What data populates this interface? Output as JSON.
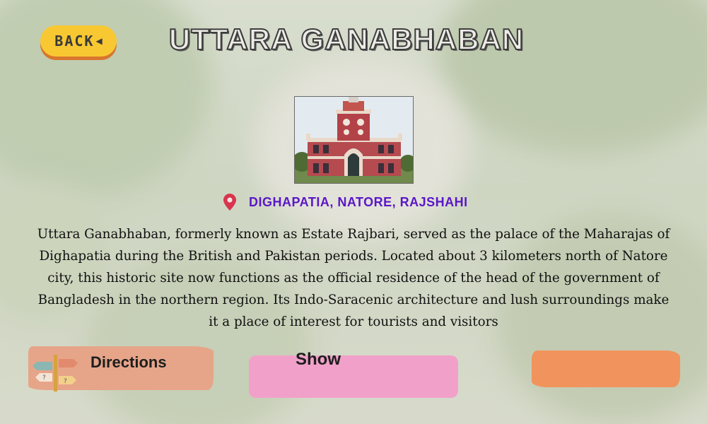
{
  "header": {
    "back_label": "BACK",
    "title": "UTTARA GANABHABAN"
  },
  "location": {
    "text": "DIGHAPATIA, NATORE, RAJSHAHI"
  },
  "description": "Uttara Ganabhaban, formerly known as Estate Rajbari, served as the palace of the Maharajas of Dighapatia during the British and Pakistan periods. Located about 3 kilometers north of Natore city, this historic site now functions as the official residence of the head of the government of Bangladesh in the northern region. Its Indo-Saracenic architecture and lush surroundings make it a place of interest for tourists and visitors",
  "actions": {
    "directions_label": "Directions",
    "show_label": "Show"
  },
  "icons": {
    "back": "back-arrow-icon",
    "location": "map-pin-icon",
    "directions": "signpost-icon"
  },
  "colors": {
    "back_button": "#f8c832",
    "location_text": "#5a16c8",
    "pin": "#d9344e",
    "directions_button": "#e6a589",
    "show_button": "#f1a1c9",
    "orange_button": "#f0935c"
  }
}
